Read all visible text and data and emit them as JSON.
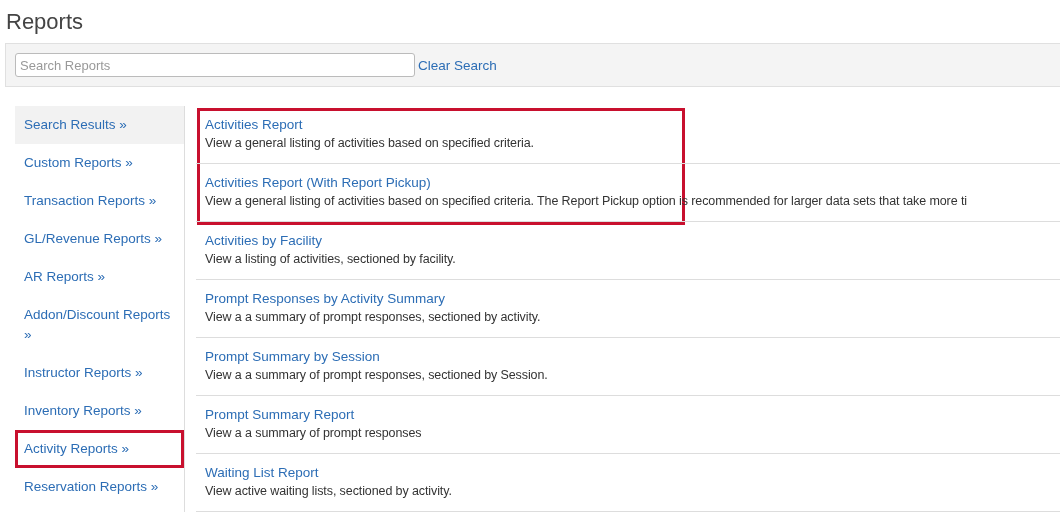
{
  "page": {
    "title": "Reports"
  },
  "search": {
    "placeholder": "Search Reports",
    "clear_link": "Clear Search"
  },
  "sidebar": {
    "items": [
      {
        "label": "Search Results »",
        "selected": true,
        "highlighted": false
      },
      {
        "label": "Custom Reports »",
        "selected": false,
        "highlighted": false
      },
      {
        "label": "Transaction Reports »",
        "selected": false,
        "highlighted": false
      },
      {
        "label": "GL/Revenue Reports »",
        "selected": false,
        "highlighted": false
      },
      {
        "label": "AR Reports »",
        "selected": false,
        "highlighted": false
      },
      {
        "label": "Addon/Discount Reports »",
        "selected": false,
        "highlighted": false
      },
      {
        "label": "Instructor Reports »",
        "selected": false,
        "highlighted": false
      },
      {
        "label": "Inventory Reports »",
        "selected": false,
        "highlighted": false
      },
      {
        "label": "Activity Reports »",
        "selected": false,
        "highlighted": true
      },
      {
        "label": "Reservation Reports »",
        "selected": false,
        "highlighted": false
      }
    ]
  },
  "report_groups": [
    {
      "highlighted": true,
      "reports": [
        {
          "title": "Activities Report",
          "description": "View a general listing of activities based on specified criteria."
        },
        {
          "title": "Activities Report (With Report Pickup)",
          "description": "View a general listing of activities based on specified criteria. The Report Pickup option is recommended for larger data sets that take more ti"
        }
      ]
    },
    {
      "highlighted": false,
      "reports": [
        {
          "title": "Activities by Facility",
          "description": "View a listing of activities, sectioned by facility."
        },
        {
          "title": "Prompt Responses by Activity Summary",
          "description": "View a a summary of prompt responses, sectioned by activity."
        },
        {
          "title": "Prompt Summary by Session",
          "description": "View a a summary of prompt responses, sectioned by Session."
        },
        {
          "title": "Prompt Summary Report",
          "description": "View a a summary of prompt responses"
        },
        {
          "title": "Waiting List Report",
          "description": "View active waiting lists, sectioned by activity."
        }
      ]
    }
  ]
}
